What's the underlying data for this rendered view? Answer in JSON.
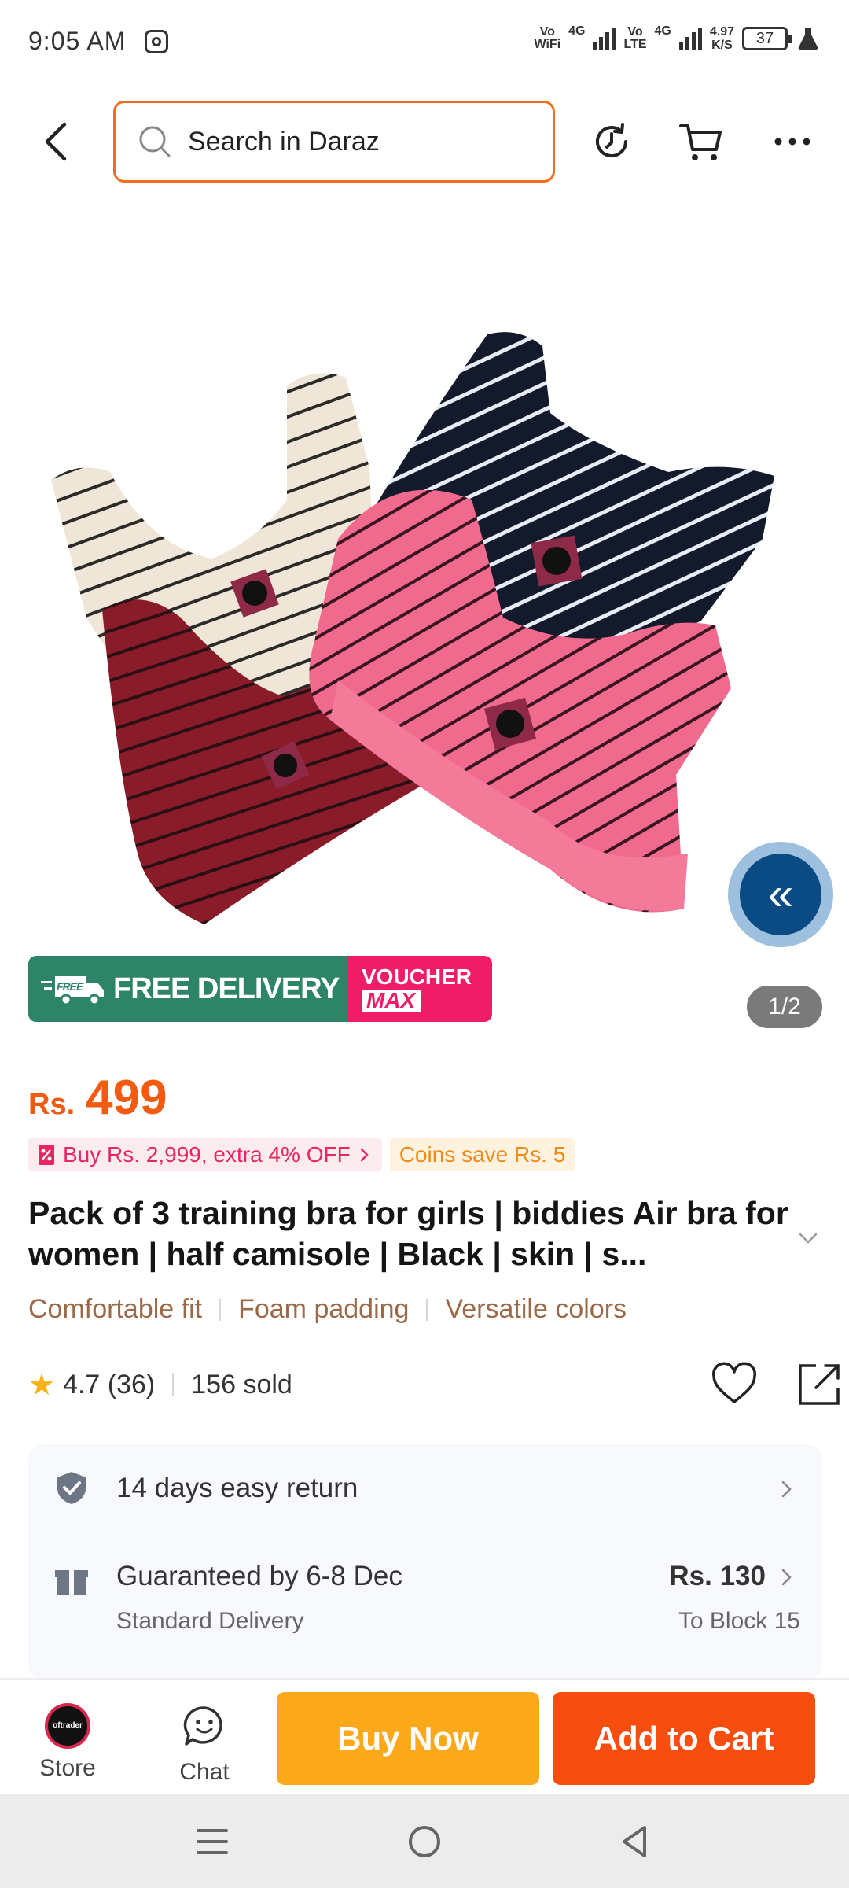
{
  "status_bar": {
    "time": "9:05 AM",
    "sim1_top": "Vo",
    "sim1_bottom": "WiFi",
    "net1": "4G",
    "sim2_top": "Vo",
    "sim2_bottom": "LTE",
    "net2": "4G",
    "speed_value": "4.97",
    "speed_unit": "K/S",
    "battery": "37"
  },
  "header": {
    "search_placeholder": "Search in Daraz"
  },
  "product_image": {
    "page_indicator": "1/2"
  },
  "badges": {
    "free_tag": "FREE",
    "free_delivery": "FREE DELIVERY",
    "voucher": "VOUCHER",
    "voucher_max": "MAX"
  },
  "price": {
    "currency": "Rs.",
    "value": "499"
  },
  "promos": {
    "voucher_text": "Buy Rs. 2,999, extra 4% OFF",
    "coins_text": "Coins save Rs. 5"
  },
  "product": {
    "title": "Pack of 3 training bra for girls |  biddies Air bra for women | half camisole | Black | skin | s...",
    "features": [
      "Comfortable fit",
      "Foam padding",
      "Versatile colors"
    ],
    "rating": "4.7 (36)",
    "sold": "156 sold"
  },
  "services": {
    "return_text": "14 days easy return",
    "delivery_main": "Guaranteed by 6-8 Dec",
    "delivery_sub": "Standard Delivery",
    "delivery_price": "Rs. 130",
    "delivery_dest": "To Block 15"
  },
  "action_bar": {
    "store_label": "Store",
    "store_avatar_text": "oftrader",
    "chat_label": "Chat",
    "buy_now": "Buy Now",
    "add_to_cart": "Add to Cart"
  },
  "colors": {
    "brand_orange": "#f36d21",
    "price_orange": "#f25a0f",
    "buy_now": "#fba91a",
    "add_to_cart": "#f74d0e",
    "free_delivery_green": "#2e8466",
    "voucher_pink": "#ef1d67",
    "feature_brown": "#9a6a48"
  }
}
